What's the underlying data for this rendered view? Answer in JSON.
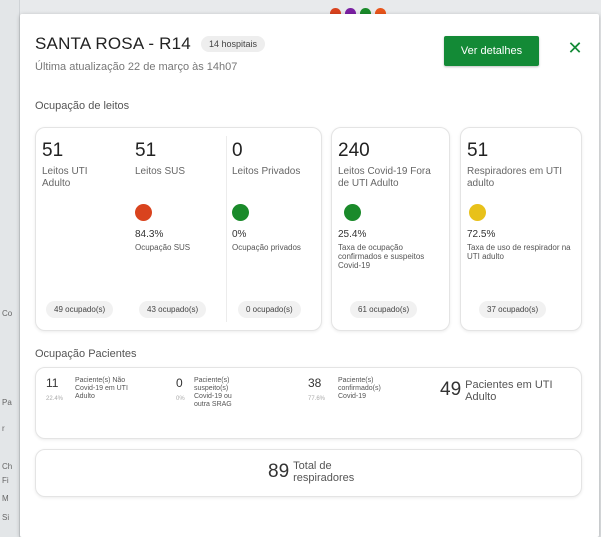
{
  "map": {
    "side_labels": [
      "Co",
      "Pa",
      "r",
      "Ch",
      "Fi",
      "M",
      "Si"
    ]
  },
  "colors": {
    "accent": "#138a36",
    "status_red": "#d9431e",
    "status_green": "#1a8a2a",
    "status_yellow": "#e8c11a",
    "top_dots": [
      "#d9431e",
      "#7a1fa2",
      "#1a8a2a",
      "#e8541a"
    ]
  },
  "header": {
    "title": "SANTA ROSA - R14",
    "hospitals_badge": "14 hospitais",
    "last_update": "Última atualização 22 de março às 14h07",
    "details_button": "Ver detalhes",
    "close_icon": "close-icon"
  },
  "beds": {
    "section_title": "Ocupação de leitos",
    "items": [
      {
        "value": "51",
        "label": "Leitos UTI Adulto",
        "status": "",
        "pct": "",
        "pct_label": "",
        "occupied": "49 ocupado(s)"
      },
      {
        "value": "51",
        "label": "Leitos SUS",
        "status": "red",
        "pct": "84.3%",
        "pct_label": "Ocupação SUS",
        "occupied": "43 ocupado(s)"
      },
      {
        "value": "0",
        "label": "Leitos Privados",
        "status": "green",
        "pct": "0%",
        "pct_label": "Ocupação privados",
        "occupied": "0 ocupado(s)"
      },
      {
        "value": "240",
        "label": "Leitos Covid-19 Fora de UTI Adulto",
        "status": "green",
        "pct": "25.4%",
        "pct_label": "Taxa de ocupação confirmados e suspeitos Covid-19",
        "occupied": "61 ocupado(s)"
      },
      {
        "value": "51",
        "label": "Respiradores em UTI adulto",
        "status": "yellow",
        "pct": "72.5%",
        "pct_label": "Taxa de uso de respirador na UTI adulto",
        "occupied": "37 ocupado(s)"
      }
    ]
  },
  "patients": {
    "section_title": "Ocupação Pacientes",
    "items": [
      {
        "value": "11",
        "pct": "22.4%",
        "label": "Paciente(s) Não Covid-19 em UTI Adulto"
      },
      {
        "value": "0",
        "pct": "0%",
        "label": "Paciente(s) suspeito(s) Covid-19 ou outra SRAG"
      },
      {
        "value": "38",
        "pct": "77.6%",
        "label": "Paciente(s) confirmado(s) Covid-19"
      }
    ],
    "total_value": "49",
    "total_label": "Pacientes em UTI Adulto"
  },
  "respirators": {
    "total_value": "89",
    "total_label": "Total de respiradores"
  }
}
